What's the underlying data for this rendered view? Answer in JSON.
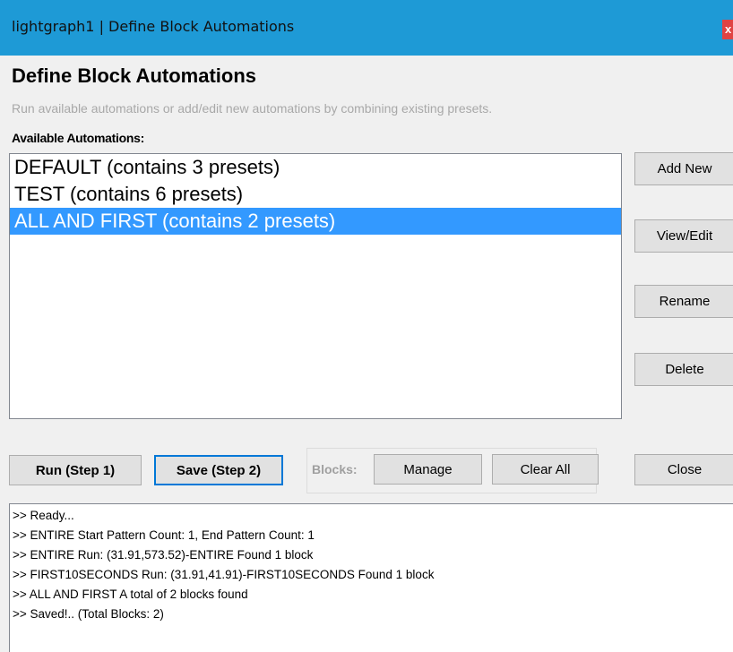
{
  "window": {
    "title": "lightgraph1 | Define Block Automations",
    "close_glyph": "x"
  },
  "header": {
    "title": "Define Block Automations",
    "subtitle": "Run available automations or add/edit new automations by combining existing presets."
  },
  "automations": {
    "label": "Available Automations:",
    "items": [
      {
        "label": "DEFAULT (contains 3 presets)",
        "selected": false
      },
      {
        "label": "TEST (contains 6 presets)",
        "selected": false
      },
      {
        "label": "ALL AND FIRST (contains 2 presets)",
        "selected": true
      }
    ]
  },
  "side_buttons": {
    "add_new": "Add New",
    "view_edit": "View/Edit",
    "rename": "Rename",
    "delete": "Delete"
  },
  "bottom_buttons": {
    "run": "Run (Step 1)",
    "save": "Save (Step 2)",
    "close": "Close"
  },
  "blocks": {
    "label": "Blocks:",
    "manage": "Manage",
    "clear_all": "Clear All"
  },
  "log": {
    "lines": [
      ">> Ready...",
      ">> ENTIRE Start Pattern Count: 1, End Pattern Count: 1",
      ">> ENTIRE Run: (31.91,573.52)-ENTIRE  Found 1 block",
      ">> FIRST10SECONDS Run: (31.91,41.91)-FIRST10SECONDS Found 1 block",
      ">> ALL AND FIRST A total of 2 blocks found",
      ">> Saved!.. (Total Blocks: 2)"
    ]
  },
  "colors": {
    "titlebar": "#1e9ad6",
    "selection": "#3399ff",
    "focus_border": "#0078d7",
    "close_button": "#e04343"
  }
}
